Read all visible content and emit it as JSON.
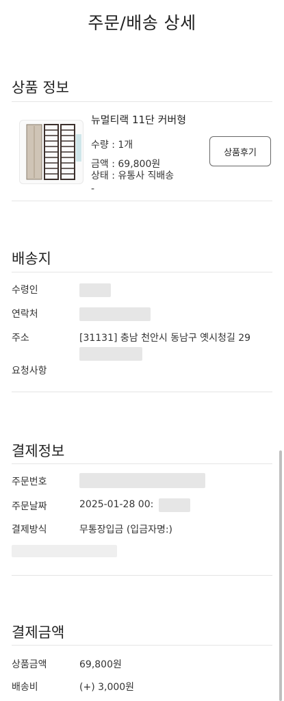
{
  "header": {
    "title": "주문/배송 상세"
  },
  "product_section": {
    "title": "상품 정보",
    "product": {
      "name": "뉴멀티랙 11단 커버형",
      "quantity": "수량 : 1개",
      "amount": "금액 : 69,800원",
      "status": "상태 : 유통사 직배송",
      "extra": "-",
      "review_button": "상품후기"
    }
  },
  "shipping_section": {
    "title": "배송지",
    "recipient_label": "수령인",
    "contact_label": "연락처",
    "address_label": "주소",
    "address_value": "[31131] 충남 천안시 동남구 옛시청길 29",
    "request_label": "요청사항"
  },
  "payment_section": {
    "title": "결제정보",
    "order_no_label": "주문번호",
    "order_date_label": "주문날짜",
    "order_date_value": "2025-01-28 00:",
    "method_label": "결제방식",
    "method_value": "무통장입금 (입금자명:)"
  },
  "amount_section": {
    "title": "결제금액",
    "product_amount_label": "상품금액",
    "product_amount_value": "69,800원",
    "shipping_fee_label": "배송비",
    "shipping_fee_value": "(+) 3,000원"
  }
}
